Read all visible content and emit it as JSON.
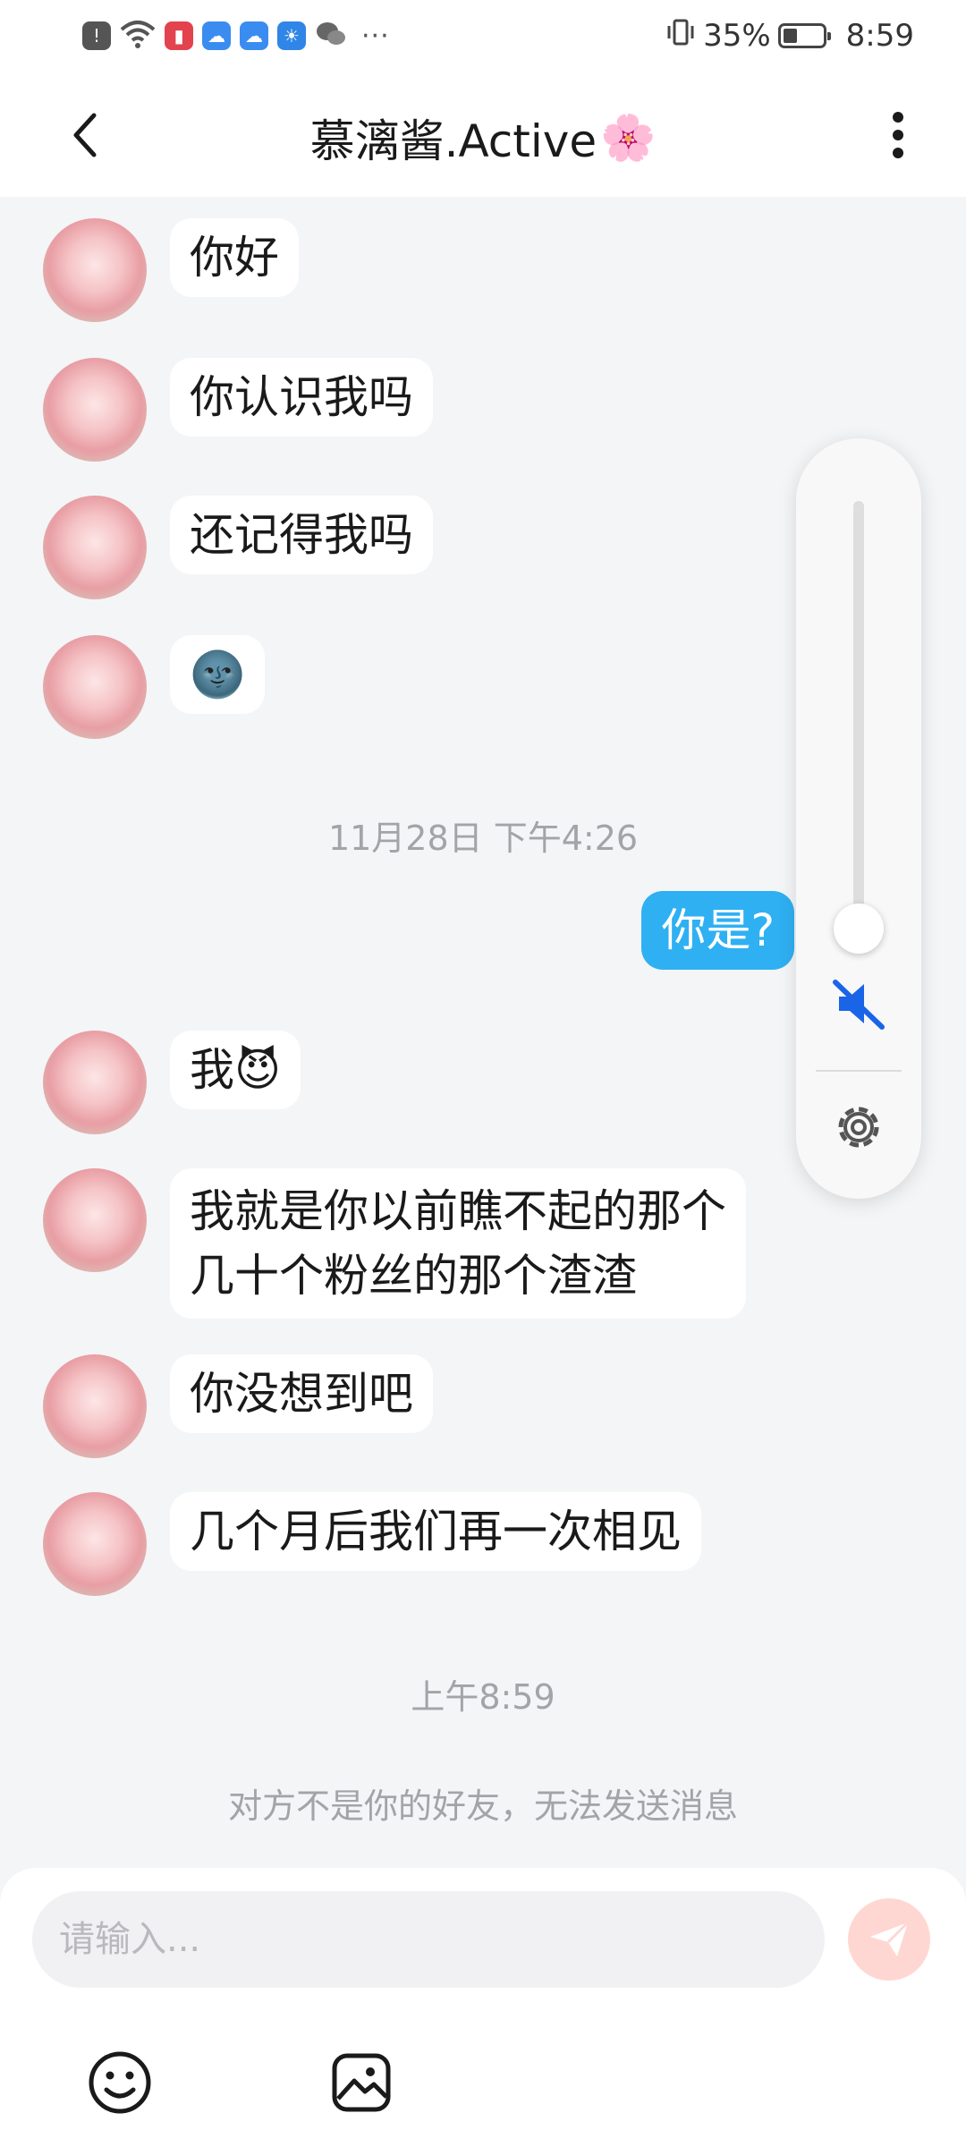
{
  "status_bar": {
    "battery_percent": "35%",
    "time": "8:59",
    "battery_level": 0.35,
    "overflow": "···",
    "icons": [
      "alert-icon",
      "wifi-icon",
      "books-app-icon",
      "cloud-icon",
      "cloud-icon",
      "weather-icon",
      "wechat-icon",
      "vibrate-icon"
    ]
  },
  "header": {
    "title": "慕漓酱.Active",
    "title_emoji": "🌸"
  },
  "messages": [
    {
      "text": "你好"
    },
    {
      "text": "你认识我吗"
    },
    {
      "text": "还记得我吗"
    },
    {
      "text": "🌚"
    },
    {
      "text": "你是?"
    },
    {
      "text": "我😈"
    },
    {
      "line1": "我就是你以前瞧不起的那个",
      "line2": "几十个粉丝的那个渣渣"
    },
    {
      "text": "你没想到吧"
    },
    {
      "text": "几个月后我们再一次相见"
    }
  ],
  "timestamps": {
    "first": "11月28日 下午4:26",
    "second": "上午8:59"
  },
  "notice": "对方不是你的好友，无法发送消息",
  "input": {
    "placeholder": "请输入..."
  },
  "volume": {
    "level": 0,
    "muted": true
  },
  "colors": {
    "sent_bubble": "#2fb0f2",
    "send_button": "#ffd7d2",
    "mute_icon": "#1a64e8",
    "background": "#f4f5f7"
  }
}
